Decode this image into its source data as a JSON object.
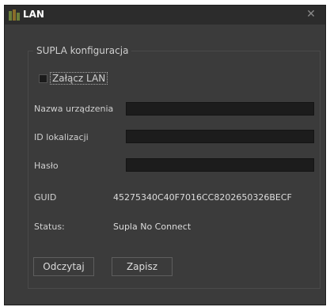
{
  "window": {
    "title": "LAN",
    "close_glyph": "✕"
  },
  "group": {
    "title": "SUPLA konfiguracja"
  },
  "checkbox": {
    "label": "Załącz LAN",
    "checked": false
  },
  "fields": {
    "device_name_label": "Nazwa urządzenia",
    "location_id_label": "ID lokalizacji",
    "password_label": "Hasło",
    "device_name_value": "",
    "location_id_value": "",
    "password_value": ""
  },
  "info": {
    "guid_label": "GUID",
    "guid_value": "45275340C40F7016CC8202650326BECF",
    "status_label": "Status:",
    "status_value": "Supla No Connect"
  },
  "buttons": {
    "read": "Odczytaj",
    "save": "Zapisz"
  },
  "colors": {
    "window_bg": "#3b3b3b",
    "titlebar_bg": "#2c2c2c",
    "field_bg": "#1c1c1c",
    "text": "#cfcfcf"
  },
  "icons": {
    "app": "supla-app-icon",
    "close": "close-icon"
  }
}
